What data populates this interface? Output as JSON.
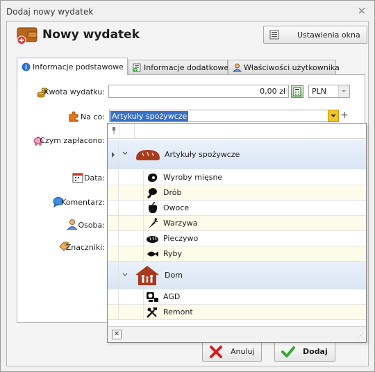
{
  "window": {
    "title": "Dodaj nowy wydatek"
  },
  "header": {
    "title": "Nowy wydatek",
    "settings_label": "Ustawienia okna"
  },
  "tabs": [
    {
      "label": "Informacje podstawowe"
    },
    {
      "label": "Informacje dodatkowe"
    },
    {
      "label": "Właściwości użytkownika"
    }
  ],
  "form": {
    "amount_label": "Kwota wydatku:",
    "amount_value": "0,00 zł",
    "currency": "PLN",
    "category_label": "Na co:",
    "category_value": "Artykuły spożywcze",
    "payment_label": "Czym zapłacono:",
    "date_label": "Data:",
    "comment_label": "Komentarz:",
    "person_label": "Osoba:",
    "tags_label": "Znaczniki:"
  },
  "dropdown": {
    "groups": [
      {
        "label": "Artykuły spożywcze",
        "items": [
          "Wyroby mięsne",
          "Drób",
          "Owoce",
          "Warzywa",
          "Pieczywo",
          "Ryby"
        ]
      },
      {
        "label": "Dom",
        "items": [
          "AGD",
          "Remont"
        ]
      }
    ]
  },
  "buttons": {
    "cancel_label": "Anuluj",
    "add_label": "Dodaj"
  },
  "colors": {
    "selection": "#3a70c6",
    "group_row": "#dae5f4",
    "alt_row": "#fdfcea",
    "arrow_button": "#f4c430"
  }
}
